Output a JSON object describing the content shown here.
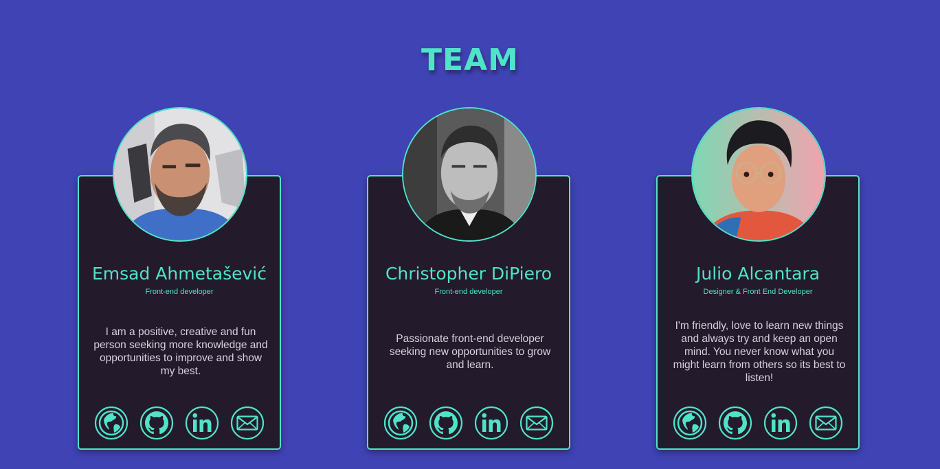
{
  "section": {
    "title": "TEAM"
  },
  "colors": {
    "background": "#4043b4",
    "accent": "#50e3c8",
    "card": "#231a2b",
    "text": "#d8d2dc"
  },
  "members": [
    {
      "name": "Emsad Ahmetašević",
      "role": "Front-end developer",
      "bio": "I am a positive, creative and fun person seeking more knowledge and opportunities to improve and show my best.",
      "links": [
        "globe-icon",
        "github-icon",
        "linkedin-icon",
        "mail-icon"
      ]
    },
    {
      "name": "Christopher DiPiero",
      "role": "Front-end developer",
      "bio": "Passionate front-end developer seeking new opportunities to grow and learn.",
      "links": [
        "globe-icon",
        "github-icon",
        "linkedin-icon",
        "mail-icon"
      ]
    },
    {
      "name": "Julio Alcantara",
      "role": "Designer & Front End Developer",
      "bio": "I'm friendly, love to learn new things and always try and keep an open mind. You never know what you might learn from others so its best to listen!",
      "links": [
        "globe-icon",
        "github-icon",
        "linkedin-icon",
        "mail-icon"
      ]
    }
  ]
}
